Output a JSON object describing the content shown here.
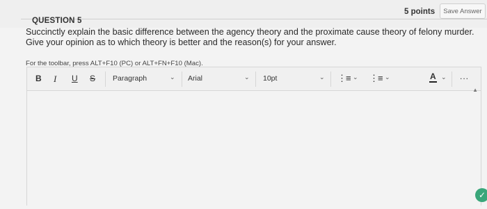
{
  "question": {
    "title": "QUESTION 5",
    "points": "5 points",
    "save_label": "Save Answer",
    "text": "Succinctly explain the basic difference between the agency theory and the proximate cause theory of felony murder. Give your opinion as to which theory is better and the reason(s) for your answer.",
    "hint": "For the toolbar, press ALT+F10 (PC) or ALT+FN+F10 (Mac)."
  },
  "toolbar": {
    "bold": "B",
    "italic": "I",
    "underline": "U",
    "strike": "S",
    "paragraph": "Paragraph",
    "font": "Arial",
    "size": "10pt",
    "font_color": "A",
    "more": "..."
  },
  "editor": {
    "value": ""
  }
}
